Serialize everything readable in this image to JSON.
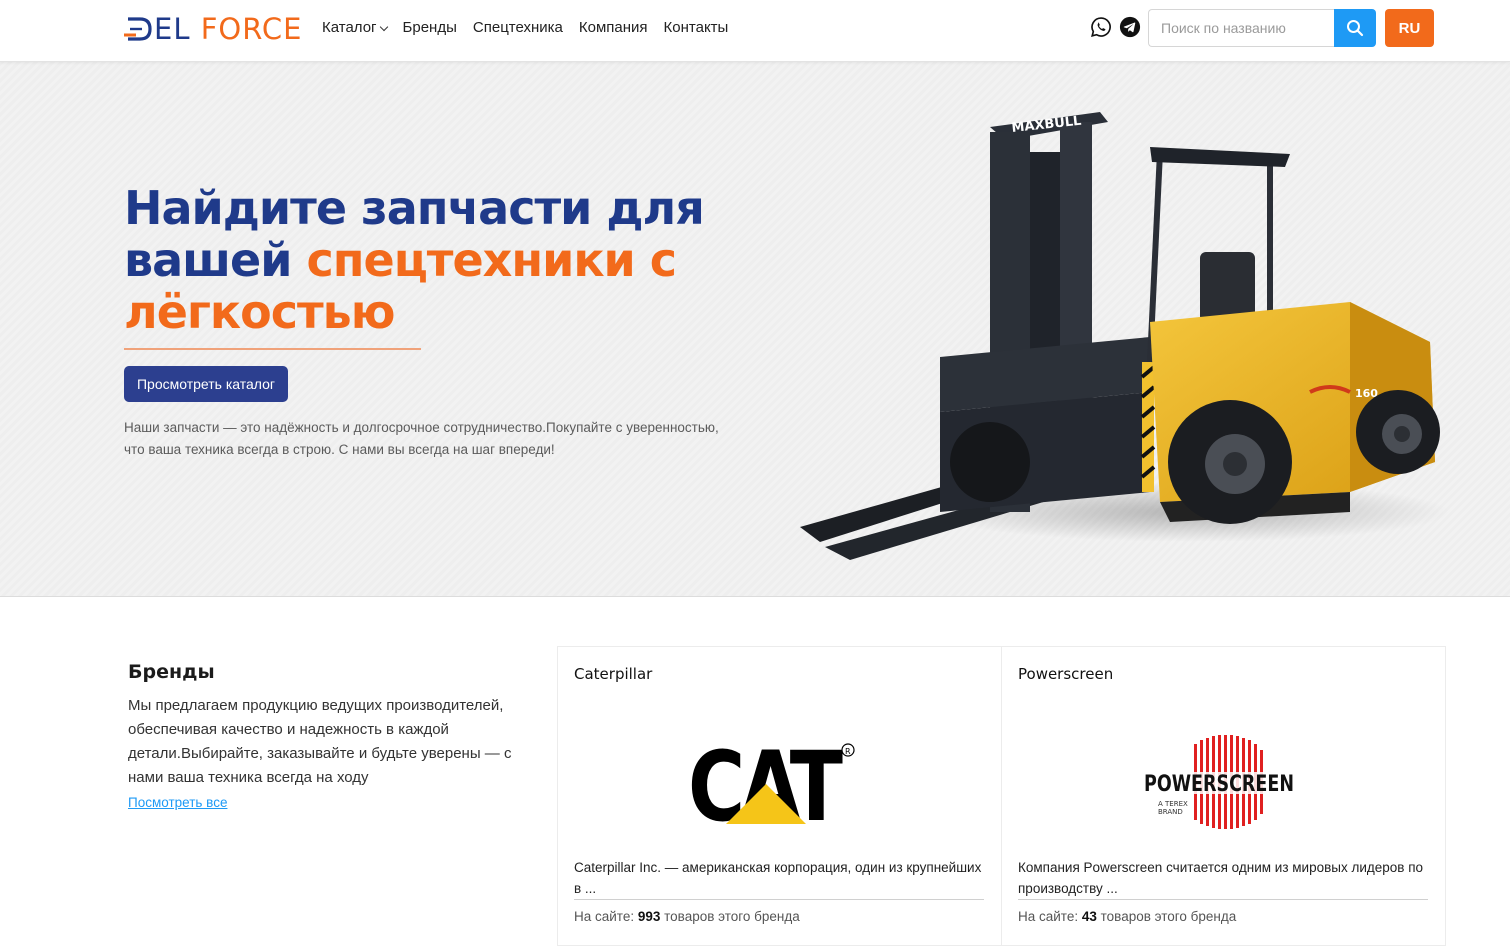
{
  "header": {
    "logo": {
      "part1": "EL ",
      "part2": "FORCE"
    },
    "nav": [
      {
        "label": "Каталог",
        "has_dropdown": true
      },
      {
        "label": "Бренды"
      },
      {
        "label": "Спецтехника"
      },
      {
        "label": "Компания"
      },
      {
        "label": "Контакты"
      }
    ],
    "social": [
      "whatsapp-icon",
      "telegram-icon"
    ],
    "search": {
      "placeholder": "Поиск по названию",
      "value": ""
    },
    "language": "RU",
    "colors": {
      "brand_blue": "#1f3a8a",
      "brand_orange": "#f26a1b",
      "search_button": "#1e9af5"
    }
  },
  "hero": {
    "title_line1": "Найдите запчасти для",
    "title_line2_start": "вашей ",
    "title_line2_accent": "спецтехники с",
    "title_line3_accent": "лёгкостью",
    "cta_label": "Просмотреть каталог",
    "description": "Наши запчасти — это надёжность и долгосрочное сотрудничество.Покупайте с уверенностью, что ваша техника всегда в строю. С нами вы всегда на шаг впереди!",
    "image_brand_text": "MAXBULL",
    "image_model_text": "160"
  },
  "brands": {
    "title": "Бренды",
    "description": "Мы предлагаем продукцию ведущих производителей, обеспечивая качество и надежность в каждой детали.Выбирайте, заказывайте и будьте уверены — с нами ваша техника всегда на ходу",
    "view_all": "Посмотреть все",
    "cards": [
      {
        "name": "Caterpillar",
        "logo_text": "CAT",
        "description": "Caterpillar Inc. — американская корпорация, один из крупнейших в ...",
        "count_prefix": "На сайте: ",
        "count": "993",
        "count_suffix": " товаров этого бренда"
      },
      {
        "name": "Powerscreen",
        "logo_text": "POWERSCREEN",
        "logo_sub1": "A TEREX",
        "logo_sub2": "BRAND",
        "description": "Компания Powerscreen считается одним из мировых лидеров по производству ...",
        "count_prefix": "На сайте: ",
        "count": "43",
        "count_suffix": " товаров этого бренда"
      }
    ]
  }
}
